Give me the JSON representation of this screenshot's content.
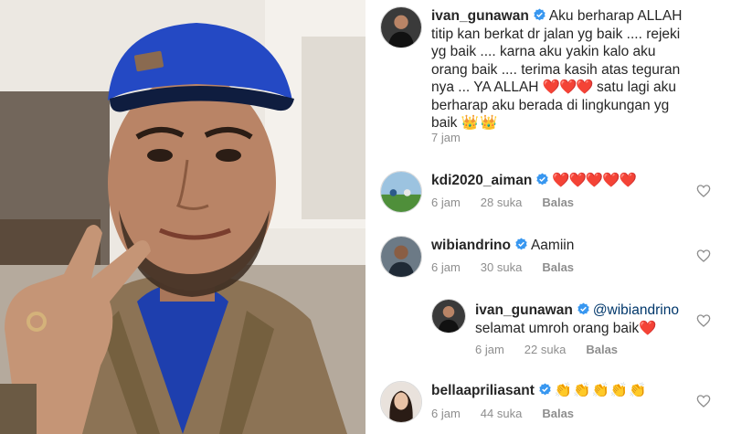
{
  "comments": [
    {
      "username": "ivan_gunawan",
      "text_lines": [
        "Aku berharap  ALLAH",
        "titip  kan  berkat  dr jalan  yg  baik .... rejeki",
        "yg baik .... karna  aku  yakin  kalo  aku",
        "orang  baik .... terima  kasih  atas teguran",
        "nya ... YA ALLAH",
        "satu  lagi  aku",
        "berharap  aku  berada di lingkungan  yg",
        "baik"
      ],
      "hearts_inline": "❤️❤️❤️",
      "emoji_tail": "👑👑",
      "time": "7 jam"
    },
    {
      "username": "kdi2020_aiman",
      "text": "❤️❤️❤️❤️❤️",
      "time": "6 jam",
      "likes": "28 suka",
      "reply_label": "Balas"
    },
    {
      "username": "wibiandrino",
      "text": "Aamiin",
      "time": "6 jam",
      "likes": "30 suka",
      "reply_label": "Balas"
    },
    {
      "username": "ivan_gunawan",
      "mention": "@wibiandrino",
      "text": "selamat  umroh orang baik",
      "heart": "❤️",
      "time": "6 jam",
      "likes": "22 suka",
      "reply_label": "Balas"
    },
    {
      "username": "bellaapriliasant",
      "text": "👏👏👏👏👏",
      "time": "6 jam",
      "likes": "44 suka",
      "reply_label": "Balas"
    }
  ],
  "icons": {
    "verified": "verified-badge-icon",
    "like": "heart-outline-icon"
  },
  "colors": {
    "verified_blue": "#3897f0",
    "heart_red": "#ed1c24",
    "meta_gray": "#8e8e8e"
  }
}
